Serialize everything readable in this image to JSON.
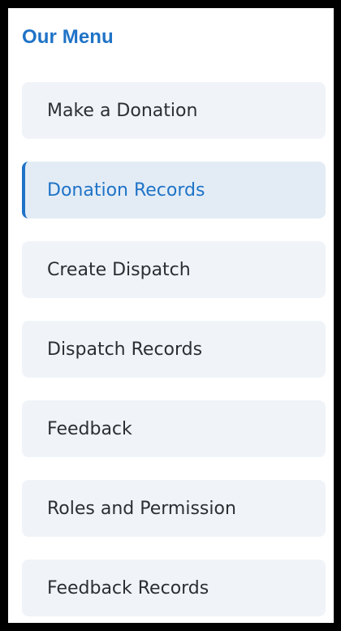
{
  "menu": {
    "title": "Our Menu",
    "active_index": 1,
    "items": [
      {
        "label": "Make a Donation"
      },
      {
        "label": "Donation Records"
      },
      {
        "label": "Create Dispatch"
      },
      {
        "label": "Dispatch Records"
      },
      {
        "label": "Feedback"
      },
      {
        "label": "Roles and Permission"
      },
      {
        "label": "Feedback Records"
      }
    ]
  },
  "colors": {
    "accent": "#1f73c7",
    "item_background": "#f0f4f8",
    "active_item_background": "#e3ecf5",
    "text": "#2b2f33",
    "frame_border": "#000000"
  }
}
